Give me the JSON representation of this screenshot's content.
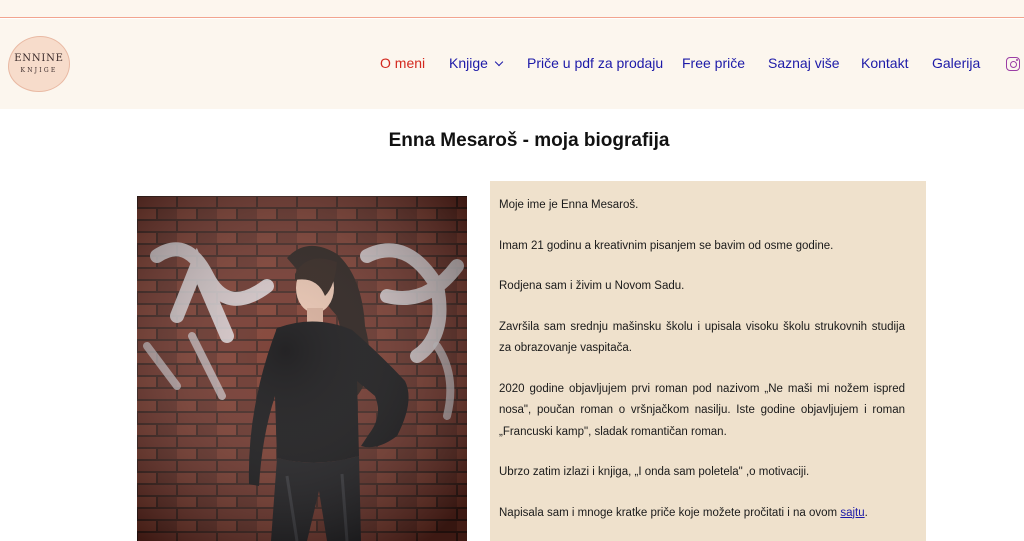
{
  "logo": {
    "line1": "ENNINE",
    "line2": "KNJIGE"
  },
  "nav": {
    "items": [
      {
        "label": "O meni",
        "active": true
      },
      {
        "label": "Knjige",
        "has_dropdown": true
      },
      {
        "label": "Priče u pdf za prodaju"
      },
      {
        "label": "Free priče"
      },
      {
        "label": "Saznaj više"
      },
      {
        "label": "Kontakt"
      },
      {
        "label": "Galerija"
      }
    ],
    "social_icon": "instagram-icon"
  },
  "page": {
    "title": "Enna Mesaroš - moja biografija"
  },
  "bio": {
    "paragraphs": [
      "Moje ime je Enna Mesaroš.",
      "Imam 21 godinu a kreativnim pisanjem se bavim od osme godine.",
      "Rodjena sam i živim u Novom Sadu.",
      "Završila sam srednju mašinsku školu i upisala visoku školu strukovnih studija za obrazovanje vaspitača.",
      "2020 godine objavljujem prvi roman pod nazivom „Ne maši mi nožem ispred nosa\", poučan roman o vršnjačkom nasilju. Iste godine objavljujem i roman „Francuski kamp\", sladak romantičan roman.",
      "Ubrzo zatim izlazi i knjiga, „I onda sam poletela\" ,o motivaciji.",
      "Napisala sam i mnoge kratke priče koje možete pročitati i na ovom"
    ],
    "link_text": "sajtu",
    "link_suffix": "."
  },
  "colors": {
    "nav_link": "#1d1aa8",
    "nav_active": "#d3281e",
    "header_bg": "#fcf6ee",
    "bio_bg": "#efe1cc"
  }
}
